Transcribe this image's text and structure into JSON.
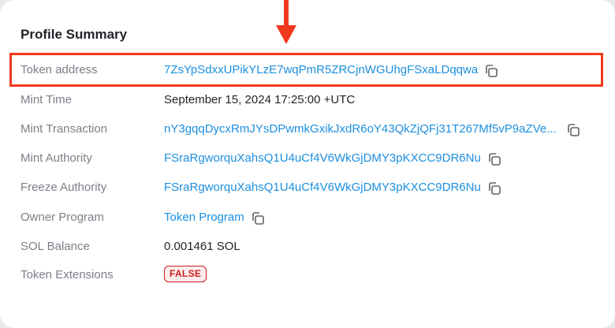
{
  "card": {
    "title": "Profile Summary"
  },
  "rows": [
    {
      "label": "Token address",
      "value": "7ZsYpSdxxUPikYLzE7wqPmR5ZRCjnWGUhgFSxaLDqqwa",
      "type": "link",
      "copy": true
    },
    {
      "label": "Mint Time",
      "value": "September 15, 2024 17:25:00 +UTC",
      "type": "text",
      "copy": false
    },
    {
      "label": "Mint Transaction",
      "value": "nY3gqqDycxRmJYsDPwmkGxikJxdR6oY43QkZjQFj31T267Mf5vP9aZVe...",
      "type": "link",
      "copy": true
    },
    {
      "label": "Mint Authority",
      "value": "FSraRgworquXahsQ1U4uCf4V6WkGjDMY3pKXCC9DR6Nu",
      "type": "link",
      "copy": true
    },
    {
      "label": "Freeze Authority",
      "value": "FSraRgworquXahsQ1U4uCf4V6WkGjDMY3pKXCC9DR6Nu",
      "type": "link",
      "copy": true
    },
    {
      "label": "Owner Program",
      "value": "Token Program",
      "type": "link",
      "copy": true
    },
    {
      "label": "SOL Balance",
      "value": "0.001461 SOL",
      "type": "text",
      "copy": false
    },
    {
      "label": "Token Extensions",
      "value": "FALSE",
      "type": "badge",
      "copy": false
    }
  ],
  "icons": {
    "copy": "copy-icon",
    "annotation_arrow": "arrow-down-icon"
  },
  "colors": {
    "link": "#1d8fe0",
    "highlight": "#f1391e",
    "badge_text": "#c81e1e",
    "badge_bg": "#fdecec",
    "label": "#7a7f87"
  }
}
